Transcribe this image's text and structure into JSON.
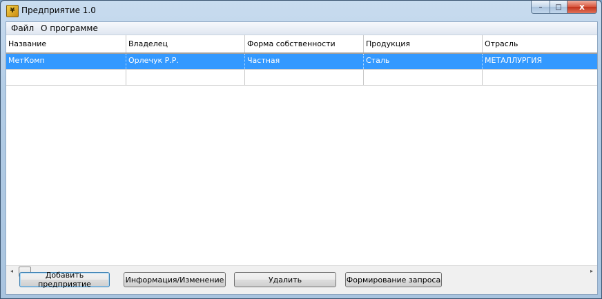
{
  "window": {
    "title": "Предприятие 1.0",
    "icon": "app-icon"
  },
  "caption_buttons": {
    "minimize": "–",
    "maximize": "□",
    "close": "x"
  },
  "menu": {
    "items": [
      {
        "label": "Файл"
      },
      {
        "label": "О программе"
      }
    ]
  },
  "table": {
    "columns": [
      "Название",
      "Владелец",
      "Форма собственности",
      "Продукция",
      "Отрасль"
    ],
    "rows": [
      [
        "МетКомп",
        "Орлечук Р.Р.",
        "Частная",
        "Сталь",
        "МЕТАЛЛУРГИЯ"
      ],
      [
        "",
        "",
        "",
        "",
        ""
      ]
    ],
    "selected_row": 0
  },
  "scrollbar": {
    "left_arrow": "◂",
    "right_arrow": "▸"
  },
  "buttons": {
    "add": "Добавить предприятие",
    "info": "Информация/Изменение",
    "delete": "Удалить",
    "query": "Формирование запроса"
  },
  "colors": {
    "selection": "#3399ff",
    "close_button": "#c2331c"
  }
}
